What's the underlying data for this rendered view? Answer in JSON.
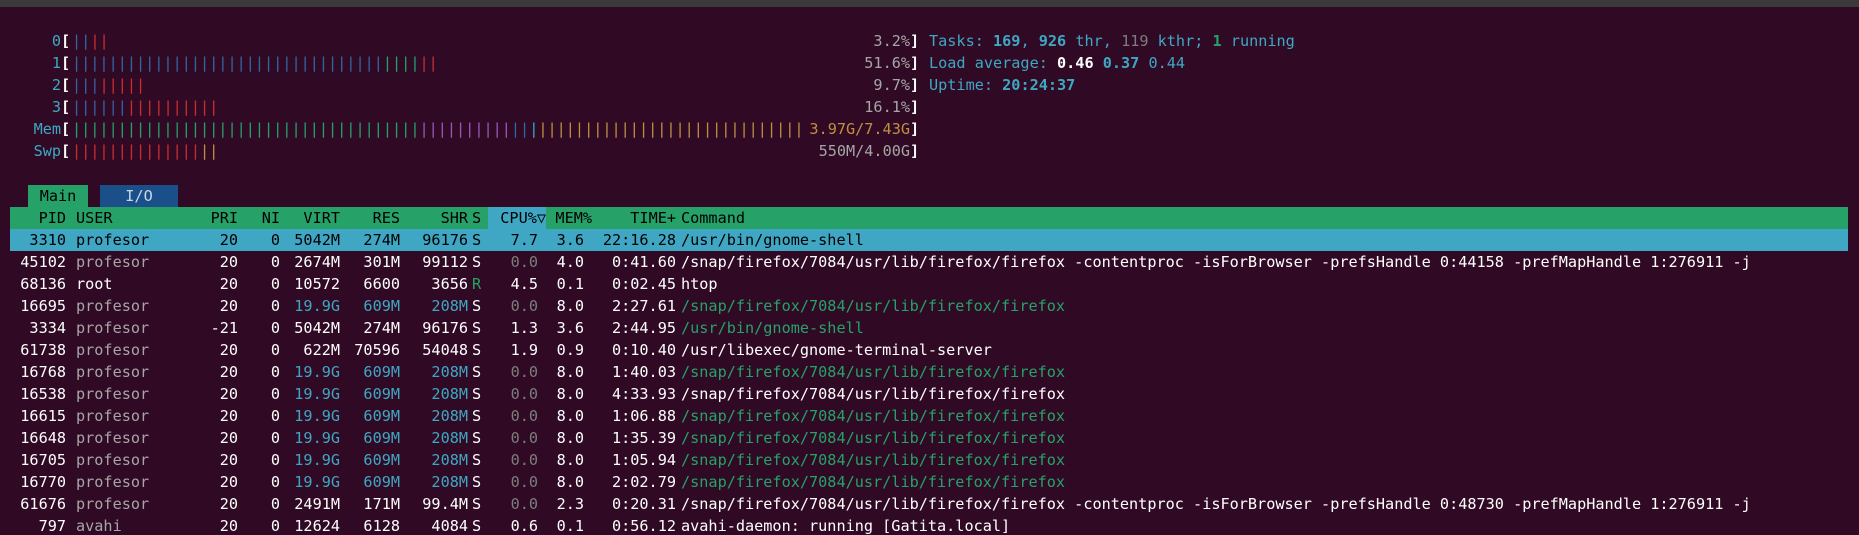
{
  "meters": {
    "cpu0": {
      "label": "0",
      "value": "3.2%"
    },
    "cpu1": {
      "label": "1",
      "value": "51.6%"
    },
    "cpu2": {
      "label": "2",
      "value": "9.7%"
    },
    "cpu3": {
      "label": "3",
      "value": "16.1%"
    },
    "mem": {
      "label": "Mem",
      "value": "3.97G/7.43G"
    },
    "swp": {
      "label": "Swp",
      "value": "550M/4.00G"
    }
  },
  "info": {
    "tasks_label": "Tasks: ",
    "tasks": "169",
    "thr": "926",
    "thr_label": " thr, ",
    "kthr": "119",
    "kthr_label": " kthr; ",
    "running": "1",
    "running_label": " running",
    "load_label": "Load average: ",
    "load1": "0.46",
    "load5": "0.37",
    "load15": "0.44",
    "uptime_label": "Uptime: ",
    "uptime": "20:24:37"
  },
  "tabs": {
    "main": "Main",
    "io": "I/O"
  },
  "columns": {
    "pid": "PID",
    "user": "USER",
    "pri": "PRI",
    "ni": "NI",
    "virt": "VIRT",
    "res": "RES",
    "shr": "SHR",
    "s": "S",
    "cpu": "CPU%▽",
    "mem": "MEM%",
    "time": "TIME+",
    "command": "Command"
  },
  "processes": [
    {
      "pid": "3310",
      "user": "profesor",
      "pri": "20",
      "ni": "0",
      "virt": "5042M",
      "res": "274M",
      "shr": "96176",
      "s": "S",
      "cpu": "7.7",
      "mem": "3.6",
      "time": "22:16.28",
      "command": "/usr/bin/gnome-shell"
    },
    {
      "pid": "45102",
      "user": "profesor",
      "pri": "20",
      "ni": "0",
      "virt": "2674M",
      "res": "301M",
      "shr": "99112",
      "s": "S",
      "cpu": "0.0",
      "mem": "4.0",
      "time": "0:41.60",
      "command": "/snap/firefox/7084/usr/lib/firefox/firefox -contentproc -isForBrowser -prefsHandle 0:44158 -prefMapHandle 1:276911 -j"
    },
    {
      "pid": "68136",
      "user": "root",
      "pri": "20",
      "ni": "0",
      "virt": "10572",
      "res": "6600",
      "shr": "3656",
      "s": "R",
      "cpu": "4.5",
      "mem": "0.1",
      "time": "0:02.45",
      "command": "htop"
    },
    {
      "pid": "16695",
      "user": "profesor",
      "pri": "20",
      "ni": "0",
      "virt": "19.9G",
      "res": "609M",
      "shr": "208M",
      "s": "S",
      "cpu": "0.0",
      "mem": "8.0",
      "time": "2:27.61",
      "command": "/snap/firefox/7084/usr/lib/firefox/firefox"
    },
    {
      "pid": "3334",
      "user": "profesor",
      "pri": "-21",
      "ni": "0",
      "virt": "5042M",
      "res": "274M",
      "shr": "96176",
      "s": "S",
      "cpu": "1.3",
      "mem": "3.6",
      "time": "2:44.95",
      "command": "/usr/bin/gnome-shell"
    },
    {
      "pid": "61738",
      "user": "profesor",
      "pri": "20",
      "ni": "0",
      "virt": "622M",
      "res": "70596",
      "shr": "54048",
      "s": "S",
      "cpu": "1.9",
      "mem": "0.9",
      "time": "0:10.40",
      "command": "/usr/libexec/gnome-terminal-server"
    },
    {
      "pid": "16768",
      "user": "profesor",
      "pri": "20",
      "ni": "0",
      "virt": "19.9G",
      "res": "609M",
      "shr": "208M",
      "s": "S",
      "cpu": "0.0",
      "mem": "8.0",
      "time": "1:40.03",
      "command": "/snap/firefox/7084/usr/lib/firefox/firefox"
    },
    {
      "pid": "16538",
      "user": "profesor",
      "pri": "20",
      "ni": "0",
      "virt": "19.9G",
      "res": "609M",
      "shr": "208M",
      "s": "S",
      "cpu": "0.0",
      "mem": "8.0",
      "time": "4:33.93",
      "command": "/snap/firefox/7084/usr/lib/firefox/firefox"
    },
    {
      "pid": "16615",
      "user": "profesor",
      "pri": "20",
      "ni": "0",
      "virt": "19.9G",
      "res": "609M",
      "shr": "208M",
      "s": "S",
      "cpu": "0.0",
      "mem": "8.0",
      "time": "1:06.88",
      "command": "/snap/firefox/7084/usr/lib/firefox/firefox"
    },
    {
      "pid": "16648",
      "user": "profesor",
      "pri": "20",
      "ni": "0",
      "virt": "19.9G",
      "res": "609M",
      "shr": "208M",
      "s": "S",
      "cpu": "0.0",
      "mem": "8.0",
      "time": "1:35.39",
      "command": "/snap/firefox/7084/usr/lib/firefox/firefox"
    },
    {
      "pid": "16705",
      "user": "profesor",
      "pri": "20",
      "ni": "0",
      "virt": "19.9G",
      "res": "609M",
      "shr": "208M",
      "s": "S",
      "cpu": "0.0",
      "mem": "8.0",
      "time": "1:05.94",
      "command": "/snap/firefox/7084/usr/lib/firefox/firefox"
    },
    {
      "pid": "16770",
      "user": "profesor",
      "pri": "20",
      "ni": "0",
      "virt": "19.9G",
      "res": "609M",
      "shr": "208M",
      "s": "S",
      "cpu": "0.0",
      "mem": "8.0",
      "time": "2:02.79",
      "command": "/snap/firefox/7084/usr/lib/firefox/firefox"
    },
    {
      "pid": "61676",
      "user": "profesor",
      "pri": "20",
      "ni": "0",
      "virt": "2491M",
      "res": "171M",
      "shr": "99.4M",
      "s": "S",
      "cpu": "0.0",
      "mem": "2.3",
      "time": "0:20.31",
      "command": "/snap/firefox/7084/usr/lib/firefox/firefox -contentproc -isForBrowser -prefsHandle 0:48730 -prefMapHandle 1:276911 -j"
    },
    {
      "pid": "797",
      "user": "avahi",
      "pri": "20",
      "ni": "0",
      "virt": "12624",
      "res": "6128",
      "shr": "4084",
      "s": "S",
      "cpu": "0.6",
      "mem": "0.1",
      "time": "0:56.12",
      "command": "avahi-daemon: running [Gatita.local]"
    }
  ],
  "colors": {
    "background": "#300a24",
    "header_bg": "#26a269",
    "selection_bg": "#3fa7c3",
    "accent_cyan": "#3fa7c3",
    "green": "#26a269",
    "blue": "#3465a4",
    "red": "#cc2e2e"
  }
}
